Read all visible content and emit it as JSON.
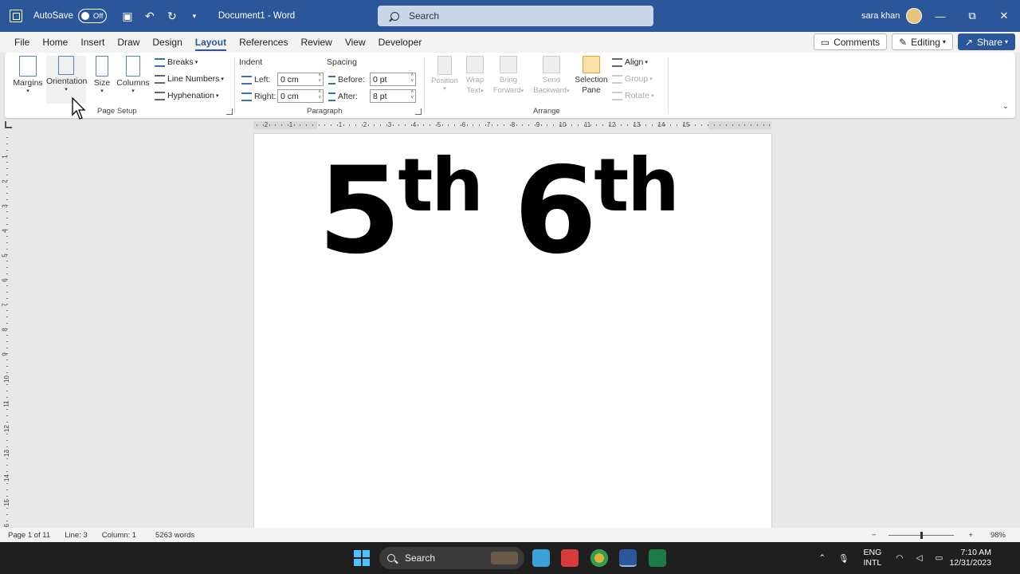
{
  "titlebar": {
    "autosave_label": "AutoSave",
    "autosave_state": "Off",
    "doc_title": "Document1  -  Word",
    "search_placeholder": "Search",
    "user_name": "sara khan",
    "minimize": "—",
    "maximize": "⧉",
    "close": "✕"
  },
  "tabs": [
    "File",
    "Home",
    "Insert",
    "Draw",
    "Design",
    "Layout",
    "References",
    "Review",
    "View",
    "Developer"
  ],
  "active_tab": "Layout",
  "header_buttons": {
    "comments": "Comments",
    "editing": "Editing",
    "share": "Share"
  },
  "ribbon": {
    "page_setup": {
      "margins": "Margins",
      "orientation": "Orientation",
      "size": "Size",
      "columns": "Columns",
      "breaks": "Breaks",
      "line_numbers": "Line Numbers",
      "hyphenation": "Hyphenation",
      "group_label": "Page Setup"
    },
    "paragraph": {
      "indent_label": "Indent",
      "spacing_label": "Spacing",
      "left_label": "Left:",
      "right_label": "Right:",
      "before_label": "Before:",
      "after_label": "After:",
      "left_value": "0 cm",
      "right_value": "0 cm",
      "before_value": "0 pt",
      "after_value": "8 pt",
      "group_label": "Paragraph"
    },
    "arrange": {
      "position": "Position",
      "wrap_text_1": "Wrap",
      "wrap_text_2": "Text",
      "bring_forward_1": "Bring",
      "bring_forward_2": "Forward",
      "send_backward_1": "Send",
      "send_backward_2": "Backward",
      "selection_pane_1": "Selection",
      "selection_pane_2": "Pane",
      "align": "Align",
      "group": "Group",
      "rotate": "Rotate",
      "group_label": "Arrange"
    }
  },
  "ruler_numbers": [
    "2",
    "1",
    "1",
    "2",
    "3",
    "4",
    "5",
    "6",
    "7",
    "8",
    "9",
    "10",
    "11",
    "12",
    "13",
    "14",
    "15"
  ],
  "vruler_numbers": [
    "1",
    "2",
    "3",
    "4",
    "5",
    "6",
    "7",
    "8",
    "9",
    "10",
    "11",
    "12",
    "13",
    "14",
    "15",
    "16"
  ],
  "document": {
    "first_num": "5",
    "first_sup": "th",
    "second_num": "6",
    "second_sup": "th"
  },
  "statusbar": {
    "page": "Page 1 of 11",
    "line": "Line: 3",
    "column": "Column: 1",
    "words": "5263 words",
    "zoom": "98%",
    "zoom_minus": "−",
    "zoom_plus": "+"
  },
  "taskbar": {
    "search_label": "Search",
    "lang_1": "ENG",
    "lang_2": "INTL",
    "time": "7:10 AM",
    "date": "12/31/2023"
  },
  "colors": {
    "titlebar": "#2b579a",
    "accent": "#2b579a",
    "taskbar": "#1f1f1f"
  }
}
